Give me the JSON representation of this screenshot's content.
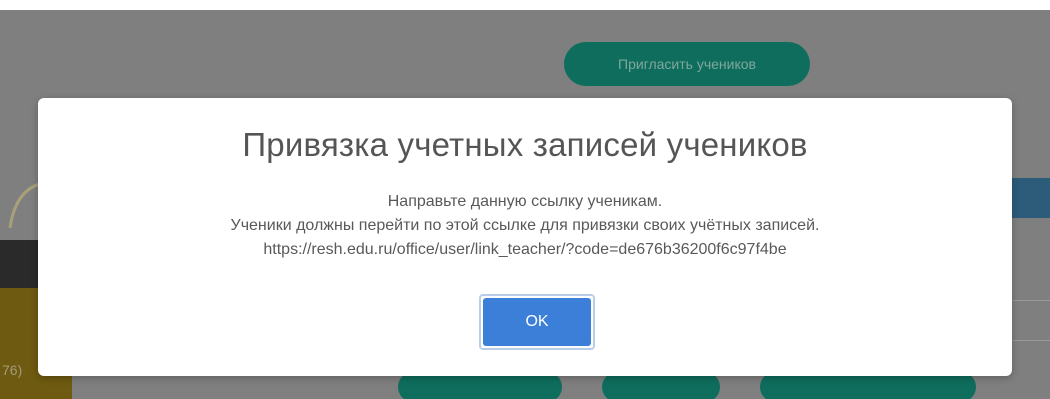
{
  "background": {
    "invite_button_label": "Пригласить учеников",
    "left_partial_text": "76)"
  },
  "modal": {
    "title": "Привязка учетных записей учеников",
    "line1": "Направьте данную ссылку ученикам.",
    "line2": "Ученики должны перейти по этой ссылке для привязки своих учётных записей.",
    "link": "https://resh.edu.ru/office/user/link_teacher/?code=de676b36200f6c97f4be",
    "ok_label": "OK"
  },
  "colors": {
    "overlay": "#7f7f7f",
    "accent_teal": "#0f6d5d",
    "ok_blue": "#3b7fd9"
  }
}
